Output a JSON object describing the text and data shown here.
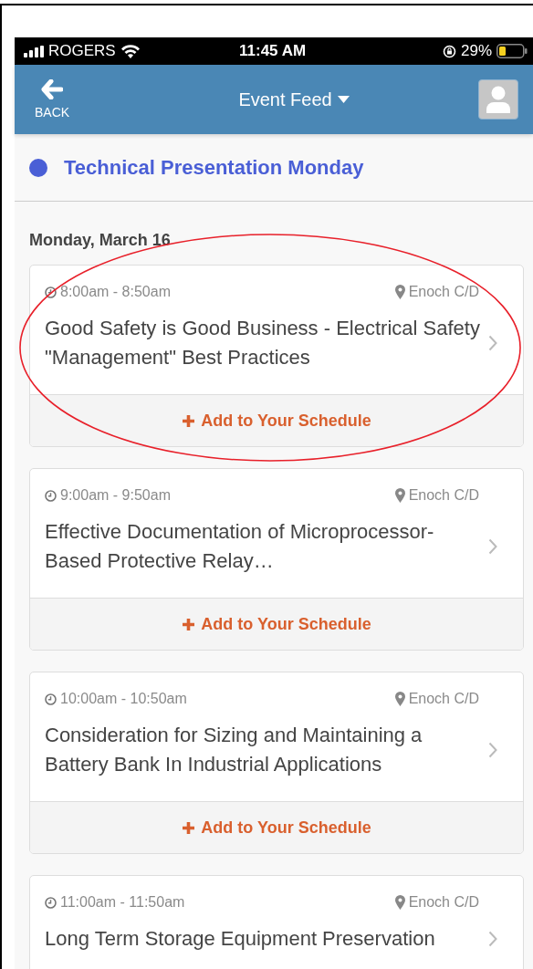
{
  "status_bar": {
    "carrier": "ROGERS",
    "time": "11:45 AM",
    "battery": "29%"
  },
  "header": {
    "back_label": "BACK",
    "title": "Event Feed"
  },
  "session": {
    "title": "Technical Presentation Monday",
    "color": "#4a5fd6"
  },
  "day_heading": "Monday, March 16",
  "events": [
    {
      "time": "8:00am - 8:50am",
      "location": "Enoch C/D",
      "title": "Good Safety is Good Business - Electrical Safety \"Management\" Best Practices",
      "action": "Add to Your Schedule"
    },
    {
      "time": "9:00am - 9:50am",
      "location": "Enoch C/D",
      "title": "Effective Documentation of Microprocessor-Based Protective Relay…",
      "action": "Add to Your Schedule"
    },
    {
      "time": "10:00am - 10:50am",
      "location": "Enoch C/D",
      "title": "Consideration for Sizing and Maintaining a Battery Bank In Industrial Applications",
      "action": "Add to Your Schedule"
    },
    {
      "time": "11:00am - 11:50am",
      "location": "Enoch C/D",
      "title": "Long Term Storage Equipment Preservation"
    }
  ]
}
